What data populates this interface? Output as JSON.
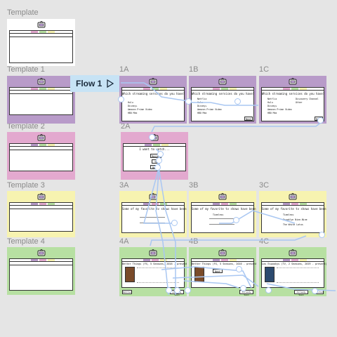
{
  "canvas": {
    "labels": {
      "template": "Template",
      "template1": "Template 1",
      "template2": "Template 2",
      "template3": "Template 3",
      "template4": "Template 4",
      "f1a": "1A",
      "f1b": "1B",
      "f1c": "1C",
      "f2a": "2A",
      "f3a": "3A",
      "f3b": "3B",
      "f3c": "3C",
      "f4a": "4A",
      "f4b": "4B",
      "f4c": "4C"
    },
    "flow_label": "Flow 1",
    "colors": {
      "background": "#e5e5e5",
      "purple": "#b89bc9",
      "pink": "#e3a9cf",
      "yellow": "#f7f3b0",
      "green": "#b7e0a2",
      "white": "#ffffff",
      "connector": "#a9c7f2",
      "flow_badge": "#c7e3f5"
    }
  },
  "screens": {
    "s1": {
      "question": "Which streaming services do you have?",
      "options": [
        "Hulu",
        "Disney+",
        "Amazon Prime Video",
        "HBO Max"
      ],
      "options_b": [
        "Netflix",
        "Hulu",
        "Disney+",
        "Amazon Prime Video",
        "HBO Max"
      ],
      "options_c_left": [
        "Netflix",
        "Hulu",
        "Disney+",
        "Amazon Prime Video",
        "HBO Max"
      ],
      "options_c_right": [
        "Discovery Channel",
        "Other"
      ],
      "next": "Next"
    },
    "s2": {
      "question": "I want to watch...",
      "choices": [
        "Movies",
        "TV",
        "Both"
      ]
    },
    "s3": {
      "question": "Some of my favorite tv shows have been...",
      "results_b": [
        "Timeless"
      ],
      "results_c": [
        "Timeless",
        "Brooklyn Nine-Nine",
        "The White Lotus"
      ]
    },
    "s4": {
      "title_a": "Better Things (FX, 5 Seasons, 2016 - present)",
      "title_b": "Better Things (FX, 5 Seasons, 2016 - present)",
      "title_c": "Los Espookys (TV, 2 Seasons, 2019 - present)",
      "btn_left": "Watched",
      "btn_right": "Already Seen",
      "btn_mid": "Next"
    }
  }
}
